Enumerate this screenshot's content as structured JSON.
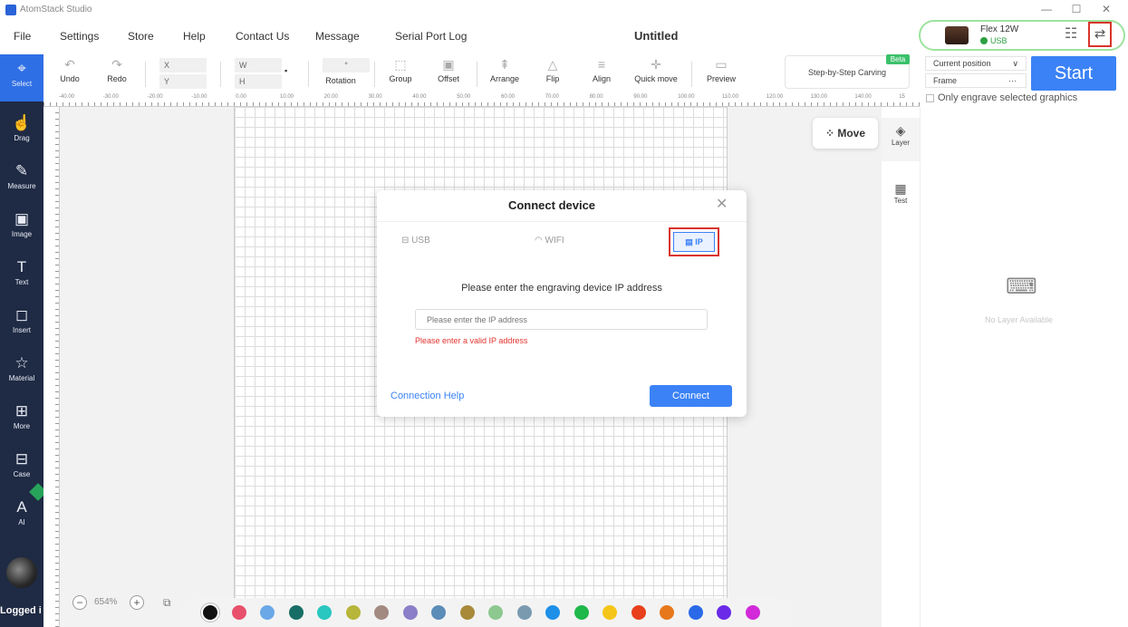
{
  "titlebar": {
    "app_name": "AtomStack Studio",
    "minimize": "—",
    "maximize": "☐",
    "close": "✕"
  },
  "menu": [
    "File",
    "Settings",
    "Store",
    "Help",
    "Contact Us",
    "Message",
    "Serial Port Log"
  ],
  "document_title": "Untitled",
  "device": {
    "name": "Flex 12W",
    "connection": "USB"
  },
  "left_toolbar": [
    {
      "label": "Select",
      "icon": "cursor-icon"
    },
    {
      "label": "Drag",
      "icon": "hand-icon"
    },
    {
      "label": "Measure",
      "icon": "pen-icon"
    },
    {
      "label": "Image",
      "icon": "image-icon"
    },
    {
      "label": "Text",
      "icon": "text-icon"
    },
    {
      "label": "Insert",
      "icon": "insert-icon"
    },
    {
      "label": "Material",
      "icon": "star-icon"
    },
    {
      "label": "More",
      "icon": "grid-icon"
    },
    {
      "label": "Case",
      "icon": "gift-icon"
    },
    {
      "label": "AI",
      "icon": "ai-icon"
    }
  ],
  "login_status": "Logged i",
  "toolbar": {
    "undo": "Undo",
    "redo": "Redo",
    "x_placeholder": "X",
    "y_placeholder": "Y",
    "w_placeholder": "W",
    "h_placeholder": "H",
    "rotation": "Rotation",
    "rotation_value": "°",
    "group": "Group",
    "offset": "Offset",
    "arrange": "Arrange",
    "flip": "Flip",
    "align": "Align",
    "quick_move": "Quick move",
    "preview": "Preview",
    "step_by_step": "Step-by-Step Carving",
    "beta": "Beta"
  },
  "run_panel": {
    "position_mode": "Current position",
    "frame": "Frame",
    "start": "Start",
    "only_engrave": "Only engrave selected graphics"
  },
  "ruler_labels": [
    "-40.00",
    "-30.00",
    "-20.00",
    "-10.00",
    "0.00",
    "10.00",
    "20.00",
    "30.00",
    "40.00",
    "50.00",
    "60.00",
    "70.00",
    "80.00",
    "90.00",
    "100.00",
    "110.00",
    "120.00",
    "130.00",
    "140.00",
    "15"
  ],
  "canvas": {
    "move": "Move"
  },
  "side_tabs": {
    "layer": "Layer",
    "test": "Test"
  },
  "layer_panel": {
    "empty": "No Layer Available"
  },
  "dialog": {
    "title": "Connect device",
    "tabs": {
      "usb": "USB",
      "wifi": "WIFI",
      "ip": "IP"
    },
    "prompt": "Please enter the engraving device IP address",
    "input_placeholder": "Please enter the IP address",
    "input_value": "",
    "error": "Please enter a valid IP address",
    "help": "Connection Help",
    "connect": "Connect"
  },
  "zoom": {
    "value": "654%",
    "minus": "−",
    "plus": "+"
  },
  "palette": [
    "#111111",
    "#e8506b",
    "#6aa8e8",
    "#176e66",
    "#2ac6c0",
    "#b7b53a",
    "#a38a80",
    "#8a7fc8",
    "#5c8cb8",
    "#a88a3a",
    "#8dc890",
    "#7a9ab0",
    "#1e90e8",
    "#1fb84a",
    "#f5c518",
    "#e8401c",
    "#e8781c",
    "#2a6ae8",
    "#6a2ae8",
    "#d22ad8"
  ],
  "colors": {
    "accent": "#3b82f6",
    "sidebar": "#1f2a44",
    "error": "#e3342f",
    "highlight": "#d9342b"
  }
}
